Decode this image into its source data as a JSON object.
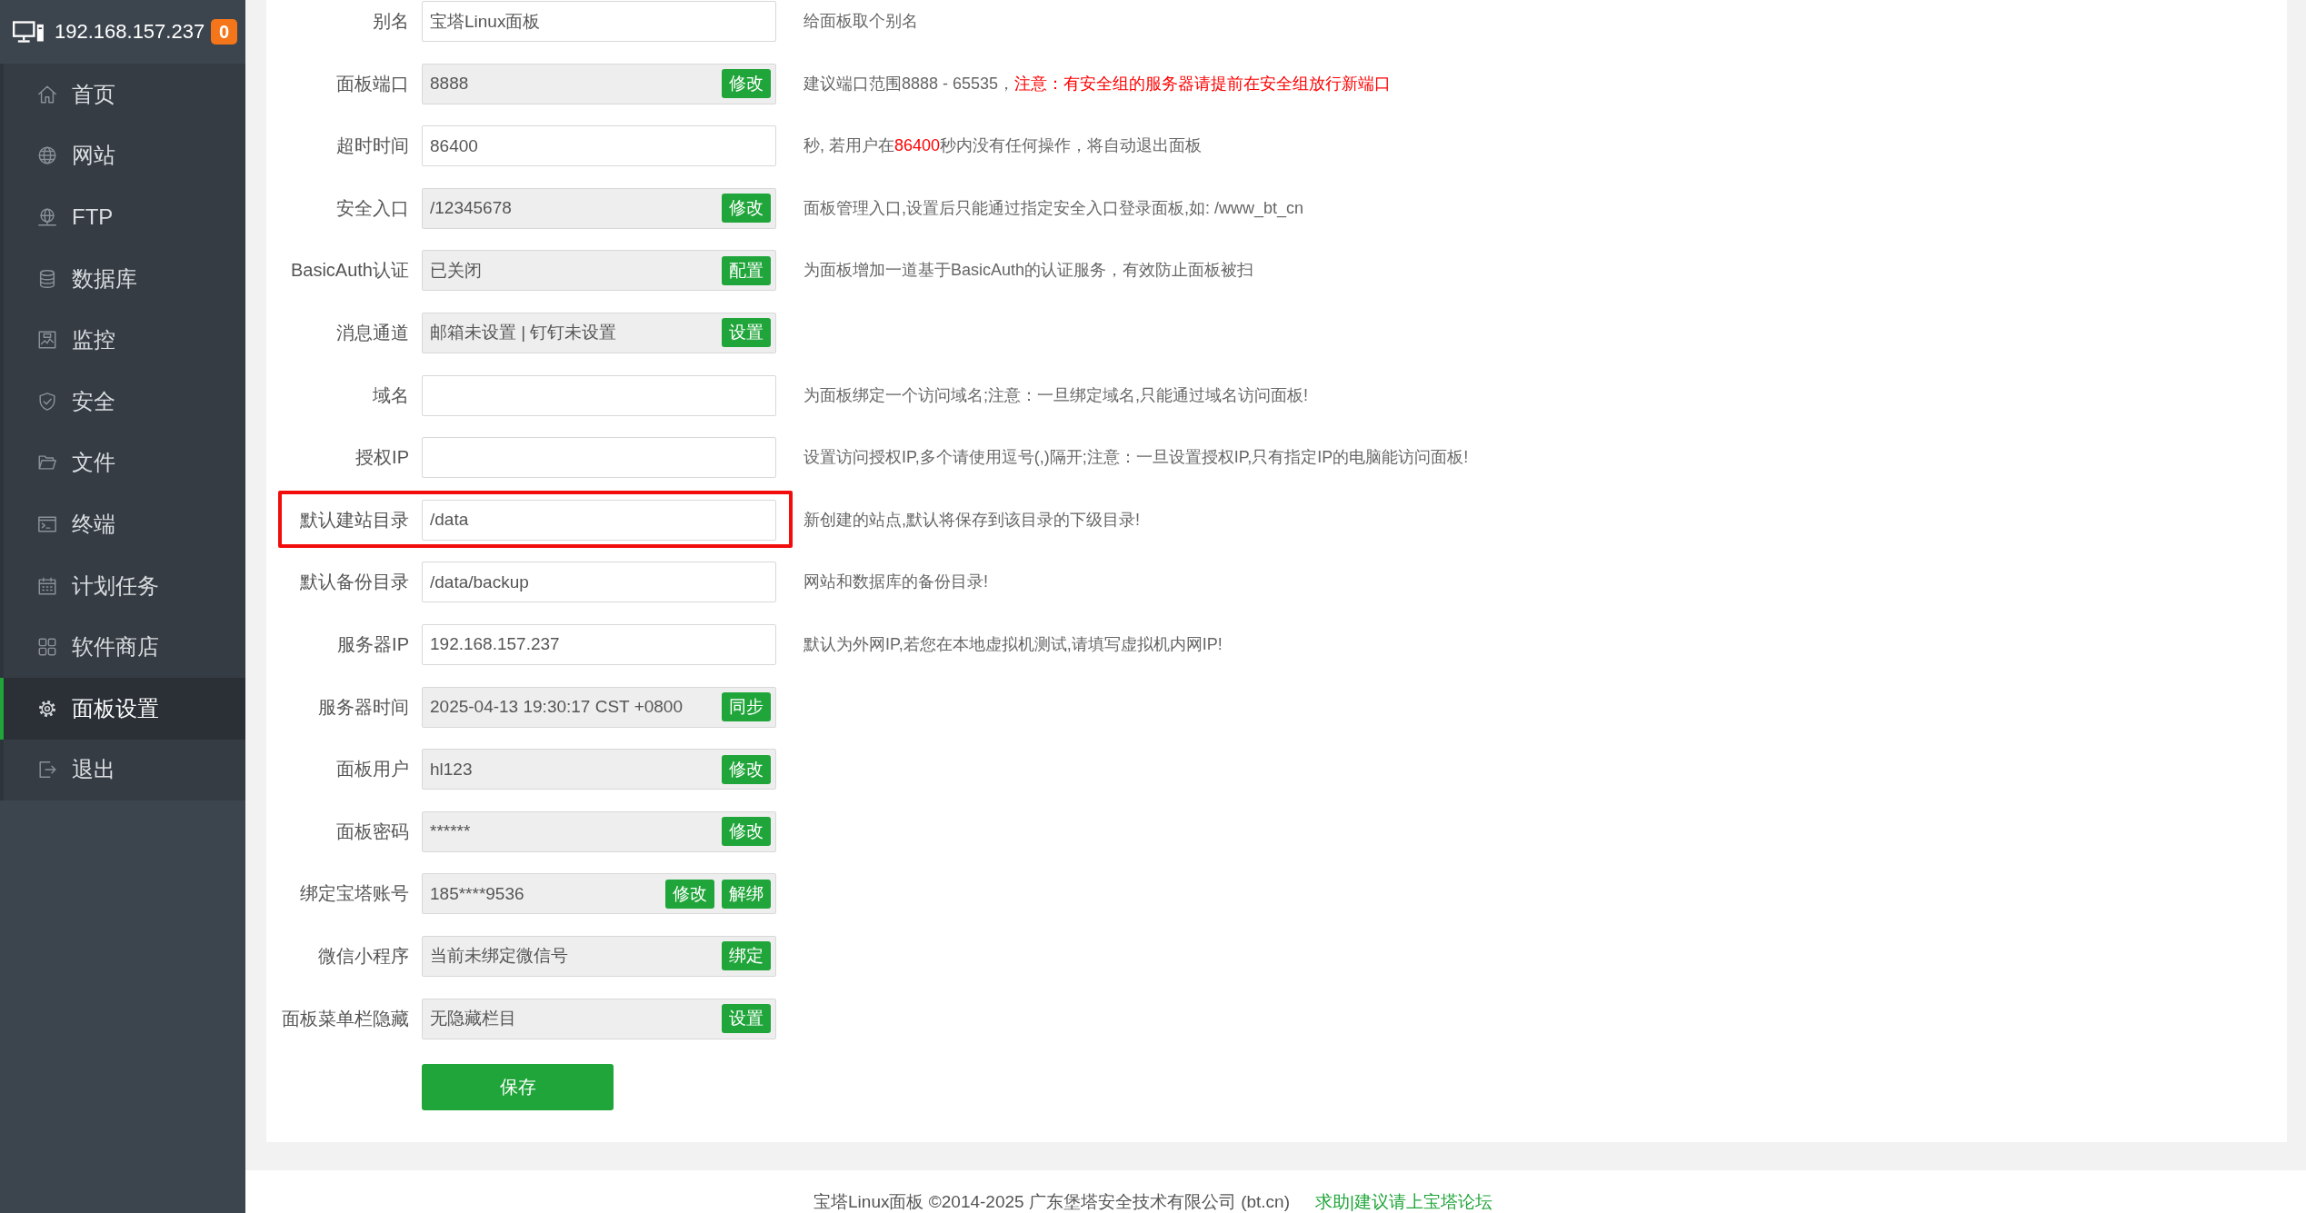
{
  "sidebar": {
    "host": "192.168.157.237",
    "badge": "0",
    "items": [
      {
        "label": "首页",
        "selected": false
      },
      {
        "label": "网站",
        "selected": false
      },
      {
        "label": "FTP",
        "selected": false
      },
      {
        "label": "数据库",
        "selected": false
      },
      {
        "label": "监控",
        "selected": false
      },
      {
        "label": "安全",
        "selected": false
      },
      {
        "label": "文件",
        "selected": false
      },
      {
        "label": "终端",
        "selected": false
      },
      {
        "label": "计划任务",
        "selected": false
      },
      {
        "label": "软件商店",
        "selected": false
      },
      {
        "label": "面板设置",
        "selected": true
      },
      {
        "label": "退出",
        "selected": false
      }
    ]
  },
  "rows": [
    {
      "label": "别名",
      "value": "宝塔Linux面板",
      "disabled": false,
      "highlighted": false,
      "hint": [
        {
          "text": "给面板取个别名",
          "warning": false
        }
      ]
    },
    {
      "label": "面板端口",
      "value": "8888",
      "disabled": true,
      "highlighted": false,
      "buttons": [
        "修改"
      ],
      "hint": [
        {
          "text": "建议端口范围8888 - 65535，",
          "warning": false
        },
        {
          "text": "注意：有安全组的服务器请提前在安全组放行新端口",
          "warning": true
        }
      ]
    },
    {
      "label": "超时时间",
      "value": "86400",
      "disabled": false,
      "highlighted": false,
      "hint": [
        {
          "text": "秒, 若用户在",
          "warning": false
        },
        {
          "text": "86400",
          "warning": true
        },
        {
          "text": "秒内没有任何操作，将自动退出面板",
          "warning": false
        }
      ]
    },
    {
      "label": "安全入口",
      "value": "/12345678",
      "disabled": true,
      "highlighted": false,
      "buttons": [
        "修改"
      ],
      "hint": [
        {
          "text": "面板管理入口,设置后只能通过指定安全入口登录面板,如: /www_bt_cn",
          "warning": false
        }
      ]
    },
    {
      "label": "BasicAuth认证",
      "value": "已关闭",
      "disabled": true,
      "highlighted": false,
      "buttons": [
        "配置"
      ],
      "hint": [
        {
          "text": "为面板增加一道基于BasicAuth的认证服务，有效防止面板被扫",
          "warning": false
        }
      ]
    },
    {
      "label": "消息通道",
      "value": "邮箱未设置 | 钉钉未设置",
      "disabled": true,
      "highlighted": false,
      "buttons": [
        "设置"
      ]
    },
    {
      "label": "域名",
      "disabled": false,
      "highlighted": false,
      "hint": [
        {
          "text": "为面板绑定一个访问域名;注意：一旦绑定域名,只能通过域名访问面板!",
          "warning": false
        }
      ]
    },
    {
      "label": "授权IP",
      "disabled": false,
      "highlighted": false,
      "hint": [
        {
          "text": "设置访问授权IP,多个请使用逗号(,)隔开;注意：一旦设置授权IP,只有指定IP的电脑能访问面板!",
          "warning": false
        }
      ]
    },
    {
      "label": "默认建站目录",
      "value": "/data",
      "disabled": false,
      "highlighted": true,
      "hint": [
        {
          "text": "新创建的站点,默认将保存到该目录的下级目录!",
          "warning": false
        }
      ]
    },
    {
      "label": "默认备份目录",
      "value": "/data/backup",
      "disabled": false,
      "highlighted": false,
      "hint": [
        {
          "text": "网站和数据库的备份目录!",
          "warning": false
        }
      ]
    },
    {
      "label": "服务器IP",
      "value": "192.168.157.237",
      "disabled": false,
      "highlighted": false,
      "hint": [
        {
          "text": "默认为外网IP,若您在本地虚拟机测试,请填写虚拟机内网IP!",
          "warning": false
        }
      ]
    },
    {
      "label": "服务器时间",
      "value": "2025-04-13 19:30:17 CST +0800",
      "disabled": true,
      "highlighted": false,
      "buttons": [
        "同步"
      ]
    },
    {
      "label": "面板用户",
      "value": "hl123",
      "disabled": true,
      "highlighted": false,
      "buttons": [
        "修改"
      ]
    },
    {
      "label": "面板密码",
      "value": "******",
      "disabled": true,
      "highlighted": false,
      "buttons": [
        "修改"
      ]
    },
    {
      "label": "绑定宝塔账号",
      "value": "185****9536",
      "disabled": true,
      "highlighted": false,
      "buttons": [
        "修改",
        "解绑"
      ]
    },
    {
      "label": "微信小程序",
      "value": "当前未绑定微信号",
      "disabled": true,
      "highlighted": false,
      "buttons": [
        "绑定"
      ]
    },
    {
      "label": "面板菜单栏隐藏",
      "value": "无隐藏栏目",
      "disabled": true,
      "highlighted": false,
      "buttons": [
        "设置"
      ]
    }
  ],
  "save_button": "保存",
  "footer": {
    "copyright": "宝塔Linux面板 ©2014-2025 广东堡塔安全技术有限公司 (bt.cn)",
    "link": "求助|建议请上宝塔论坛"
  }
}
